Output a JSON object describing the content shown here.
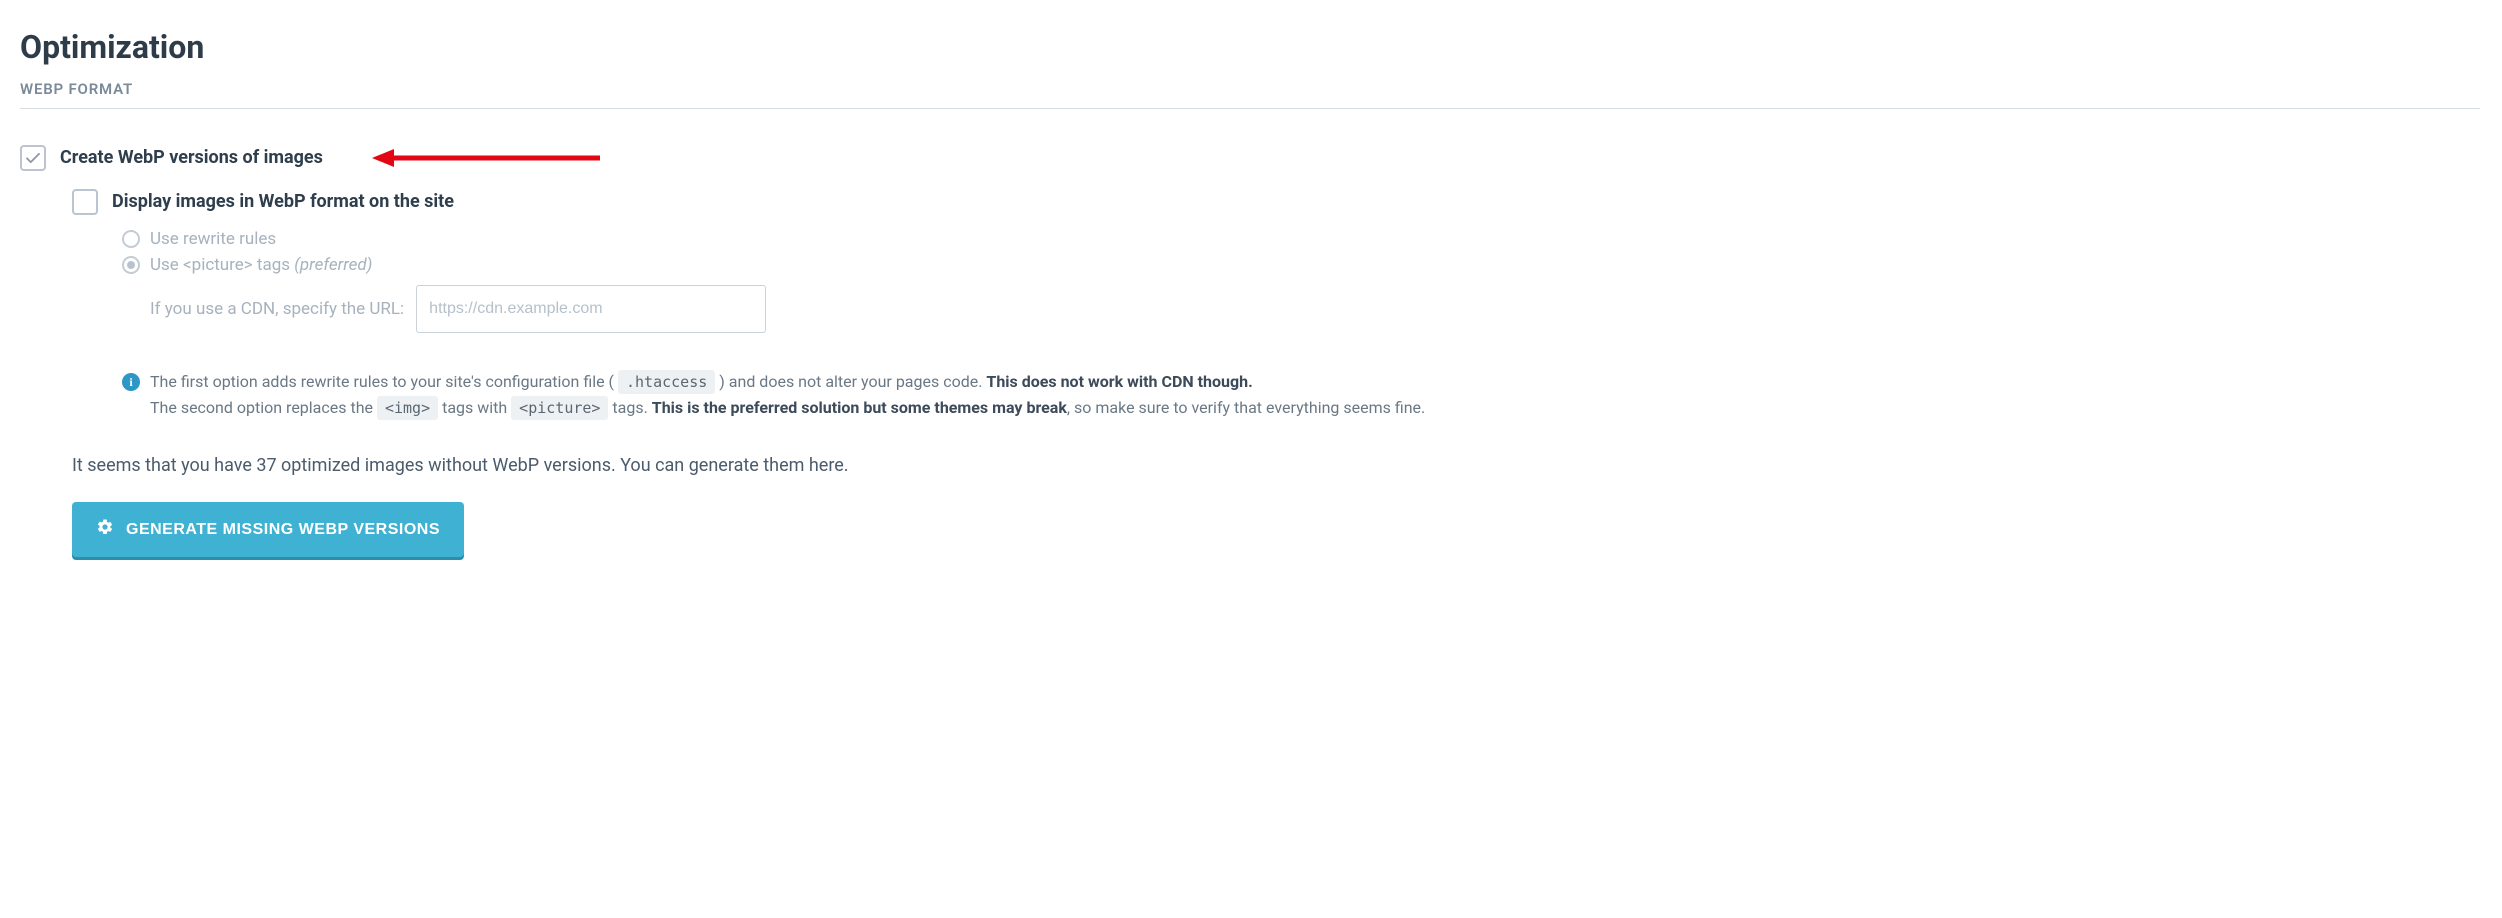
{
  "page": {
    "title": "Optimization",
    "subtitle": "WEBP FORMAT"
  },
  "options": {
    "create_webp": {
      "label": "Create WebP versions of images",
      "checked": true
    },
    "display_webp": {
      "label": "Display images in WebP format on the site",
      "checked": false,
      "methods": {
        "rewrite": {
          "label": "Use rewrite rules",
          "selected": false
        },
        "picture": {
          "label": "Use <picture> tags",
          "preferred_suffix": "(preferred)",
          "selected": true
        }
      },
      "cdn": {
        "label": "If you use a CDN, specify the URL:",
        "placeholder": "https://cdn.example.com",
        "value": ""
      }
    }
  },
  "info": {
    "line1_a": "The first option adds rewrite rules to your site's configuration file (",
    "line1_code": ".htaccess",
    "line1_b": ") and does not alter your pages code.",
    "line1_strong": "This does not work with CDN though.",
    "line2_a": "The second option replaces the",
    "line2_code1": "<img>",
    "line2_b": "tags with",
    "line2_code2": "<picture>",
    "line2_c": "tags.",
    "line2_strong": "This is the preferred solution but some themes may break",
    "line2_d": ", so make sure to verify that everything seems fine."
  },
  "status": {
    "text": "It seems that you have 37 optimized images without WebP versions. You can generate them here."
  },
  "actions": {
    "generate_label": "GENERATE MISSING WEBP VERSIONS"
  },
  "annotation": {
    "type": "arrow",
    "color": "#e30613"
  }
}
